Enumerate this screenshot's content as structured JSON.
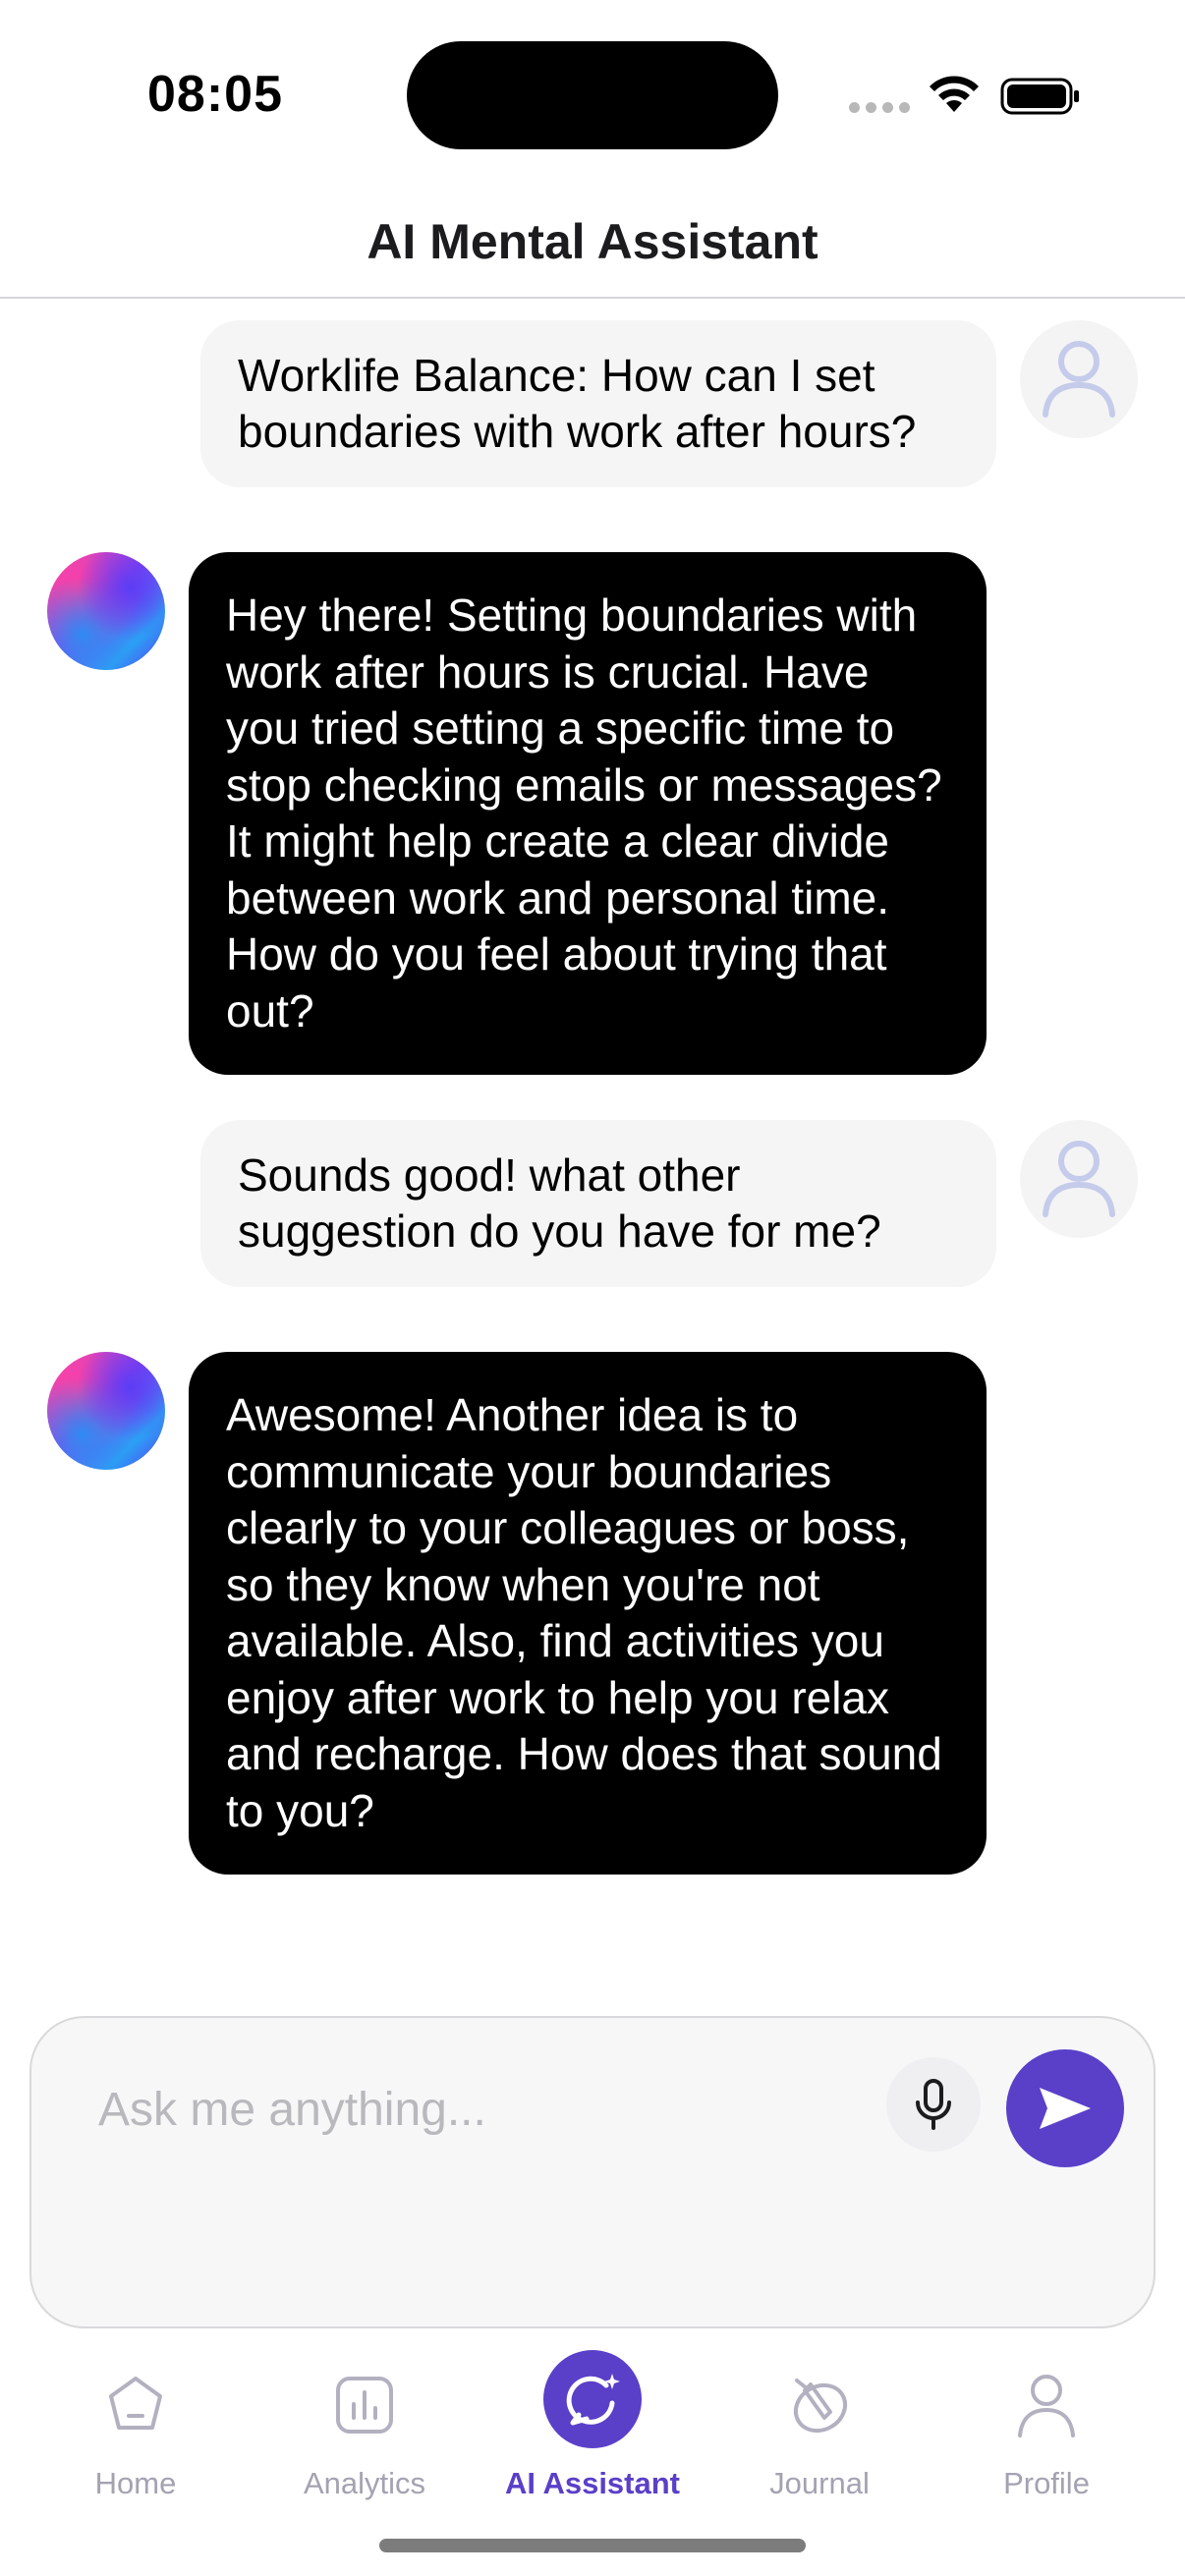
{
  "status_bar": {
    "time": "08:05"
  },
  "header": {
    "title": "AI Mental Assistant"
  },
  "messages": [
    {
      "role": "user",
      "text": "Worklife Balance: How can I set boundaries with work after hours?"
    },
    {
      "role": "assistant",
      "text": "Hey there! Setting boundaries with work after hours is crucial. Have you tried setting a specific time to stop checking emails or messages? It might help create a clear divide between work and personal time. How do you feel about trying that out?"
    },
    {
      "role": "user",
      "text": "Sounds good! what other suggestion do you have for me?"
    },
    {
      "role": "assistant",
      "text": "Awesome! Another idea is to communicate your boundaries clearly to your colleagues or boss, so they know when you're not available. Also, find activities you enjoy after work to help you relax and recharge. How does that sound to you?"
    }
  ],
  "composer": {
    "placeholder": "Ask me anything..."
  },
  "tabs": [
    {
      "label": "Home",
      "icon": "home-icon",
      "active": false
    },
    {
      "label": "Analytics",
      "icon": "analytics-icon",
      "active": false
    },
    {
      "label": "AI Assistant",
      "icon": "ai-assistant-icon",
      "active": true
    },
    {
      "label": "Journal",
      "icon": "journal-icon",
      "active": false
    },
    {
      "label": "Profile",
      "icon": "profile-icon",
      "active": false
    }
  ],
  "colors": {
    "accent": "#5a3fc9",
    "ai_bubble": "#000000",
    "user_bubble": "#f5f5f5",
    "inactive_tab": "#a4a2b2"
  }
}
